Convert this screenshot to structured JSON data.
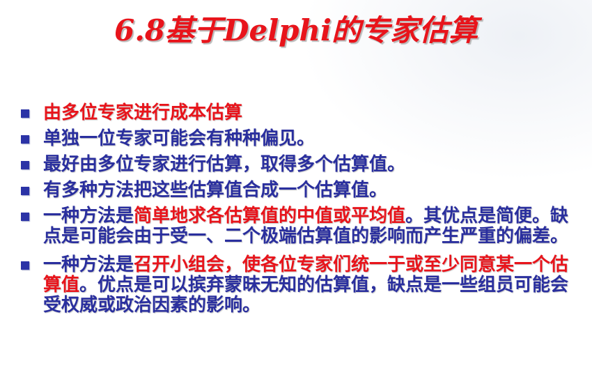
{
  "slide": {
    "title": "6.8基于Delphi的专家估算",
    "colors": {
      "red": "#e8141b",
      "blue": "#2a2f9e"
    },
    "bullets": [
      {
        "segments": [
          {
            "text": "由多位专家进行成本估算",
            "color": "red"
          }
        ]
      },
      {
        "segments": [
          {
            "text": "单独一位专家可能会有种种偏见。",
            "color": "blue"
          }
        ]
      },
      {
        "segments": [
          {
            "text": "最好由多位专家进行估算，取得多个估算值。",
            "color": "blue"
          }
        ]
      },
      {
        "segments": [
          {
            "text": "有多种方法把这些估算值合成一个估算值。",
            "color": "blue"
          }
        ]
      },
      {
        "segments": [
          {
            "text": "一种方法是",
            "color": "blue"
          },
          {
            "text": "简单地求各估算值的中值或平均值",
            "color": "red"
          },
          {
            "text": "。其优点是简便。缺点是可能会由于受一、二个极端估算值的影响而产生严重的偏差。",
            "color": "blue"
          }
        ]
      },
      {
        "segments": [
          {
            "text": "一种方法是",
            "color": "blue"
          },
          {
            "text": "召开小组会，使各位专家们统一于或至少同意某一个估算值",
            "color": "red"
          },
          {
            "text": "。优点是可以摈弃蒙昧无知的估算值，缺点是一些组员可能会受权威或政治因素的影响。",
            "color": "blue"
          }
        ]
      }
    ]
  }
}
